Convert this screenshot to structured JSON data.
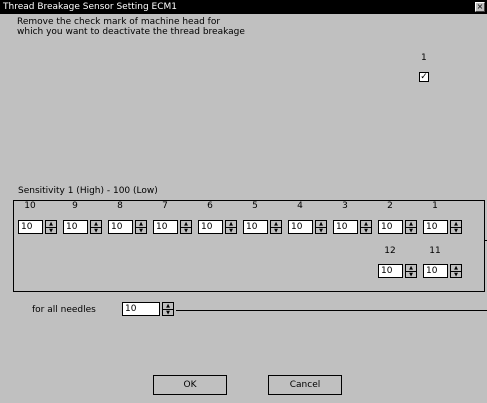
{
  "window": {
    "title": "Thread Breakage Sensor Setting ECM1",
    "close_label": "×"
  },
  "instructions": "Remove the check mark of machine head for\nwhich you want to deactivate the thread breakage",
  "head": {
    "label": "1",
    "checked": true,
    "check_mark": "✓"
  },
  "sensitivity": {
    "label": "Sensitivity 1 (High) - 100 (Low)",
    "needles_row1": [
      {
        "label": "10",
        "value": "10"
      },
      {
        "label": "9",
        "value": "10"
      },
      {
        "label": "8",
        "value": "10"
      },
      {
        "label": "7",
        "value": "10"
      },
      {
        "label": "6",
        "value": "10"
      },
      {
        "label": "5",
        "value": "10"
      },
      {
        "label": "4",
        "value": "10"
      },
      {
        "label": "3",
        "value": "10"
      },
      {
        "label": "2",
        "value": "10"
      },
      {
        "label": "1",
        "value": "10"
      }
    ],
    "needles_row2": [
      {
        "label": "12",
        "value": "10"
      },
      {
        "label": "11",
        "value": "10"
      }
    ]
  },
  "all_needles": {
    "label": "for all needles",
    "value": "10"
  },
  "buttons": {
    "ok": "OK",
    "cancel": "Cancel"
  },
  "spinner_glyphs": {
    "up": "▲",
    "down": "▼"
  }
}
